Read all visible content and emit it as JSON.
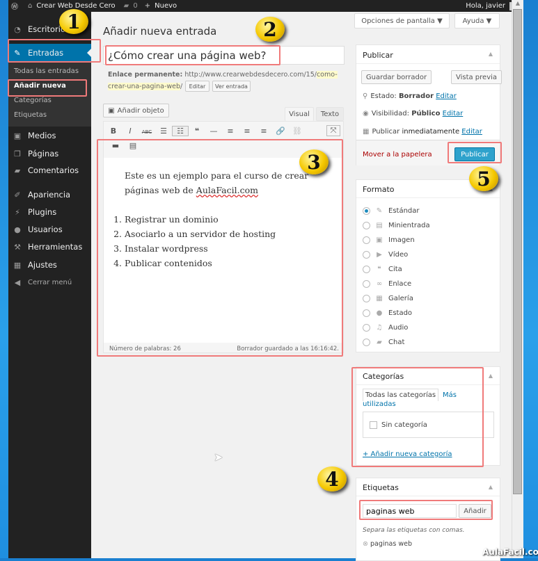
{
  "adminbar": {
    "site": "Crear Web Desde Cero",
    "comments": "0",
    "new": "Nuevo",
    "greeting": "Hola, javier"
  },
  "sidebar": {
    "items": [
      {
        "label": "Escritorio",
        "icon": "dashboard-icon"
      },
      {
        "label": "Entradas",
        "icon": "pin-icon"
      },
      {
        "label": "Medios",
        "icon": "media-icon"
      },
      {
        "label": "Páginas",
        "icon": "pages-icon"
      },
      {
        "label": "Comentarios",
        "icon": "comment-icon"
      },
      {
        "label": "Apariencia",
        "icon": "brush-icon"
      },
      {
        "label": "Plugins",
        "icon": "plugin-icon"
      },
      {
        "label": "Usuarios",
        "icon": "user-icon"
      },
      {
        "label": "Herramientas",
        "icon": "wrench-icon"
      },
      {
        "label": "Ajustes",
        "icon": "settings-icon"
      },
      {
        "label": "Cerrar menú",
        "icon": "collapse-icon"
      }
    ],
    "submenu": [
      "Todas las entradas",
      "Añadir nueva",
      "Categorías",
      "Etiquetas"
    ]
  },
  "header": {
    "screen_options": "Opciones de pantalla ▼",
    "help": "Ayuda ▼",
    "title": "Añadir nueva entrada"
  },
  "post": {
    "title": "¿Cómo crear una página web?",
    "permalink_label": "Enlace permanente:",
    "permalink_base": "http://www.crearwebdesdecero.com/15/",
    "permalink_slug_1": "como-",
    "permalink_slug_2": "crear-una-pagina-web",
    "permalink_end": "/",
    "edit": "Editar",
    "view": "Ver entrada"
  },
  "editor": {
    "add_media": "Añadir objeto",
    "tab_visual": "Visual",
    "tab_text": "Texto",
    "intro_1": "Este es un ejemplo para el curso de crear",
    "intro_2": "páginas web de ",
    "intro_link": "AulaFacil.com",
    "list": [
      "Registrar un dominio",
      "Asociarlo a un servidor de hosting",
      "Instalar wordpress",
      "Publicar contenidos"
    ],
    "word_count": "Número de palabras: 26",
    "saved": "Borrador guardado a las 16:16:42."
  },
  "publish": {
    "title": "Publicar",
    "save_draft": "Guardar borrador",
    "preview": "Vista previa",
    "status_label": "Estado:",
    "status": "Borrador",
    "visibility_label": "Visibilidad:",
    "visibility": "Público",
    "schedule_label": "Publicar",
    "schedule": "inmediatamente",
    "edit": "Editar",
    "trash": "Mover a la papelera",
    "publish": "Publicar"
  },
  "format": {
    "title": "Formato",
    "options": [
      {
        "label": "Estándar",
        "icon": "pin-icon",
        "checked": true
      },
      {
        "label": "Minientrada",
        "icon": "aside-icon"
      },
      {
        "label": "Imagen",
        "icon": "image-icon"
      },
      {
        "label": "Vídeo",
        "icon": "video-icon"
      },
      {
        "label": "Cita",
        "icon": "quote-icon"
      },
      {
        "label": "Enlace",
        "icon": "link-icon"
      },
      {
        "label": "Galería",
        "icon": "gallery-icon"
      },
      {
        "label": "Estado",
        "icon": "status-icon"
      },
      {
        "label": "Audio",
        "icon": "audio-icon"
      },
      {
        "label": "Chat",
        "icon": "chat-icon"
      }
    ]
  },
  "categories": {
    "title": "Categorías",
    "tab_all": "Todas las categorías",
    "tab_popular_1": "Más",
    "tab_popular_2": "utilizadas",
    "item": "Sin categoría",
    "add": "+ Añadir nueva categoría"
  },
  "tags": {
    "title": "Etiquetas",
    "input": "paginas web",
    "add": "Añadir",
    "hint": "Separa las etiquetas con comas.",
    "tag": "paginas web"
  },
  "badges": [
    "1",
    "2",
    "3",
    "4",
    "5"
  ],
  "watermark": "AulaFacil.com",
  "colors": {
    "accent": "#0073aa",
    "publish": "#2ea2cc",
    "trash": "#a00",
    "annotation": "#f07a7a",
    "sidebar": "#222"
  }
}
